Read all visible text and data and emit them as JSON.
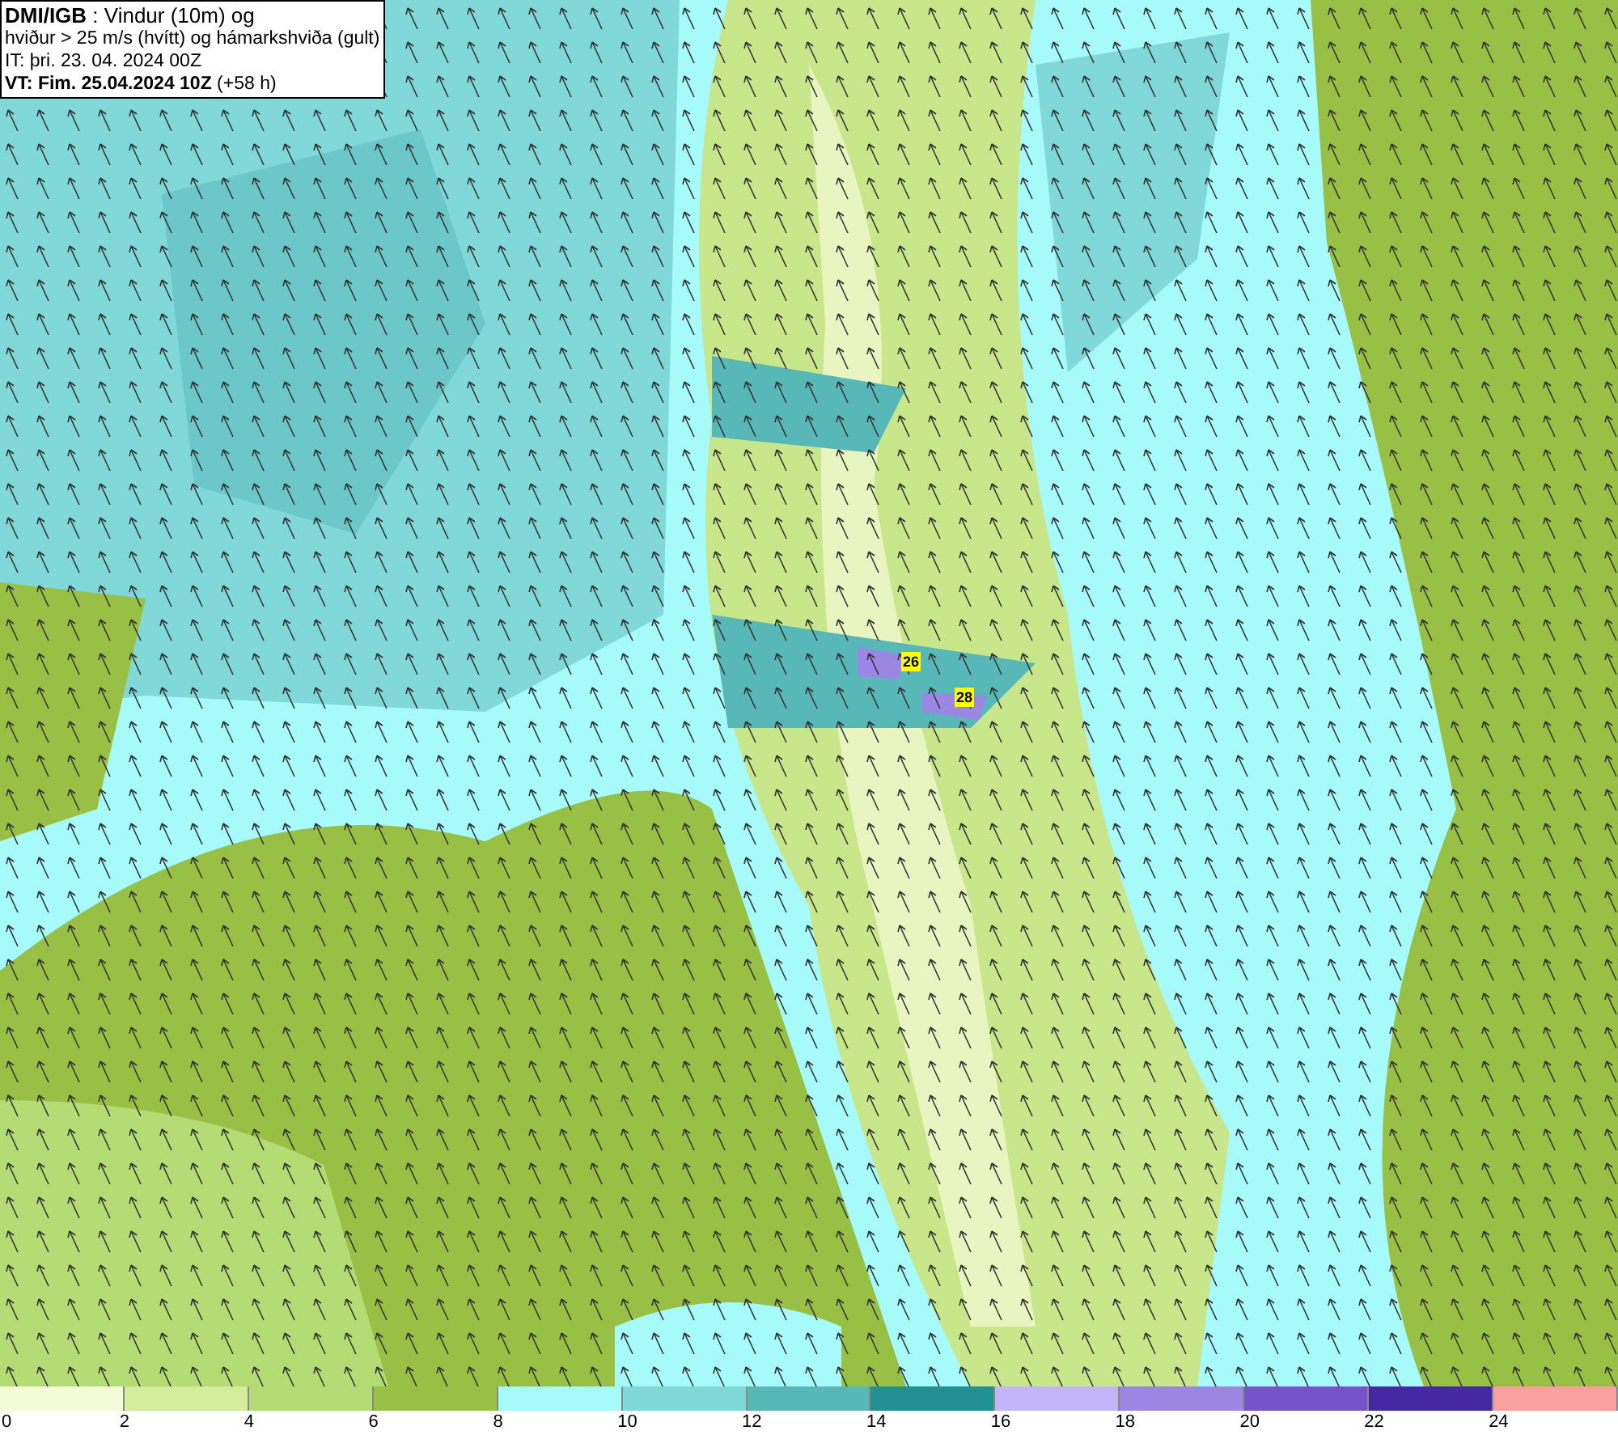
{
  "header": {
    "lines": [
      "**DMI/IGB** : Vindur (10m) og",
      "hviður > 25 m/s (hvítt) og hámarkshviða (gult)",
      "IT: þri. 23. 04. 2024 00Z",
      "**VT: Fim. 25.04.2024 10Z** (+58 h)"
    ]
  },
  "map": {
    "gust_labels": [
      "26",
      "28"
    ]
  },
  "legend": {
    "bins": [
      {
        "color": "#f4fbd9"
      },
      {
        "color": "#d3ed9c"
      },
      {
        "color": "#b3dc74"
      },
      {
        "color": "#97c045"
      },
      {
        "color": "#a6fafa"
      },
      {
        "color": "#80d8d8"
      },
      {
        "color": "#58b8b8"
      },
      {
        "color": "#229090"
      },
      {
        "color": "#c4b4f8"
      },
      {
        "color": "#9c86e4"
      },
      {
        "color": "#7454c8"
      },
      {
        "color": "#4428a4"
      },
      {
        "color": "#f8a0a0"
      }
    ],
    "ticks": [
      "0",
      "2",
      "4",
      "6",
      "8",
      "10",
      "12",
      "14",
      "16",
      "18",
      "20",
      "22",
      "24"
    ]
  }
}
